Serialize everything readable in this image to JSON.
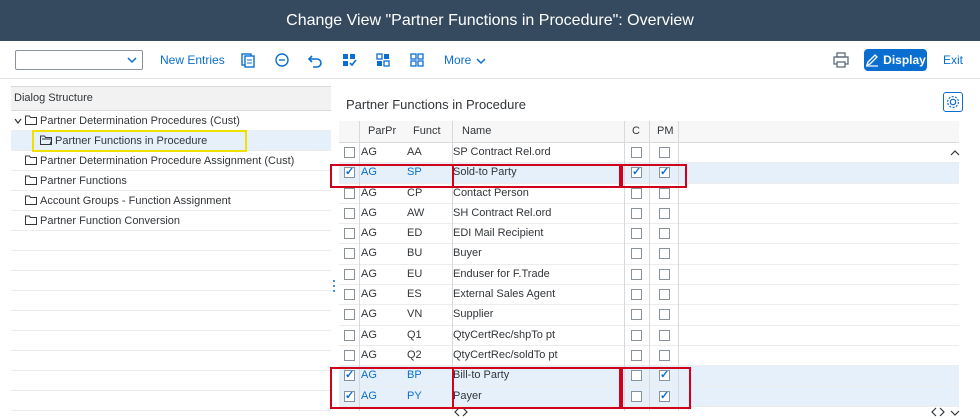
{
  "window": {
    "title": "Change View \"Partner Functions in Procedure\": Overview"
  },
  "toolbar": {
    "new_entries": "New Entries",
    "more": "More",
    "display": "Display",
    "exit": "Exit"
  },
  "dialog_structure": {
    "header": "Dialog Structure",
    "items": [
      {
        "label": "Partner Determination Procedures (Cust)"
      },
      {
        "label": "Partner Functions in Procedure"
      },
      {
        "label": "Partner Determination Procedure Assignment (Cust)"
      },
      {
        "label": "Partner Functions"
      },
      {
        "label": "Account Groups - Function Assignment"
      },
      {
        "label": "Partner Function Conversion"
      }
    ]
  },
  "main": {
    "title": "Partner Functions in Procedure",
    "columns": [
      "ParPr",
      "Funct",
      "Name",
      "C",
      "PM"
    ],
    "rows": [
      {
        "par": "AG",
        "funct": "AA",
        "name": "SP Contract Rel.ord",
        "sel": false,
        "c": false,
        "pm": false
      },
      {
        "par": "AG",
        "funct": "SP",
        "name": "Sold-to Party",
        "sel": true,
        "c": true,
        "pm": true
      },
      {
        "par": "AG",
        "funct": "CP",
        "name": "Contact Person",
        "sel": false,
        "c": false,
        "pm": false
      },
      {
        "par": "AG",
        "funct": "AW",
        "name": "SH Contract Rel.ord",
        "sel": false,
        "c": false,
        "pm": false
      },
      {
        "par": "AG",
        "funct": "ED",
        "name": "EDI Mail Recipient",
        "sel": false,
        "c": false,
        "pm": false
      },
      {
        "par": "AG",
        "funct": "BU",
        "name": "Buyer",
        "sel": false,
        "c": false,
        "pm": false
      },
      {
        "par": "AG",
        "funct": "EU",
        "name": "Enduser for F.Trade",
        "sel": false,
        "c": false,
        "pm": false
      },
      {
        "par": "AG",
        "funct": "ES",
        "name": "External Sales Agent",
        "sel": false,
        "c": false,
        "pm": false
      },
      {
        "par": "AG",
        "funct": "VN",
        "name": "Supplier",
        "sel": false,
        "c": false,
        "pm": false
      },
      {
        "par": "AG",
        "funct": "Q1",
        "name": "QtyCertRec/shpTo pt",
        "sel": false,
        "c": false,
        "pm": false
      },
      {
        "par": "AG",
        "funct": "Q2",
        "name": "QtyCertRec/soldTo pt",
        "sel": false,
        "c": false,
        "pm": false
      },
      {
        "par": "AG",
        "funct": "BP",
        "name": "Bill-to Party",
        "sel": true,
        "c": false,
        "pm": true
      },
      {
        "par": "AG",
        "funct": "PY",
        "name": "Payer",
        "sel": true,
        "c": false,
        "pm": true
      }
    ]
  },
  "colors": {
    "accent": "#0a6ed1",
    "header_bar": "#354a5f",
    "highlight_red": "#d0021b",
    "highlight_yellow": "#f0e000"
  }
}
